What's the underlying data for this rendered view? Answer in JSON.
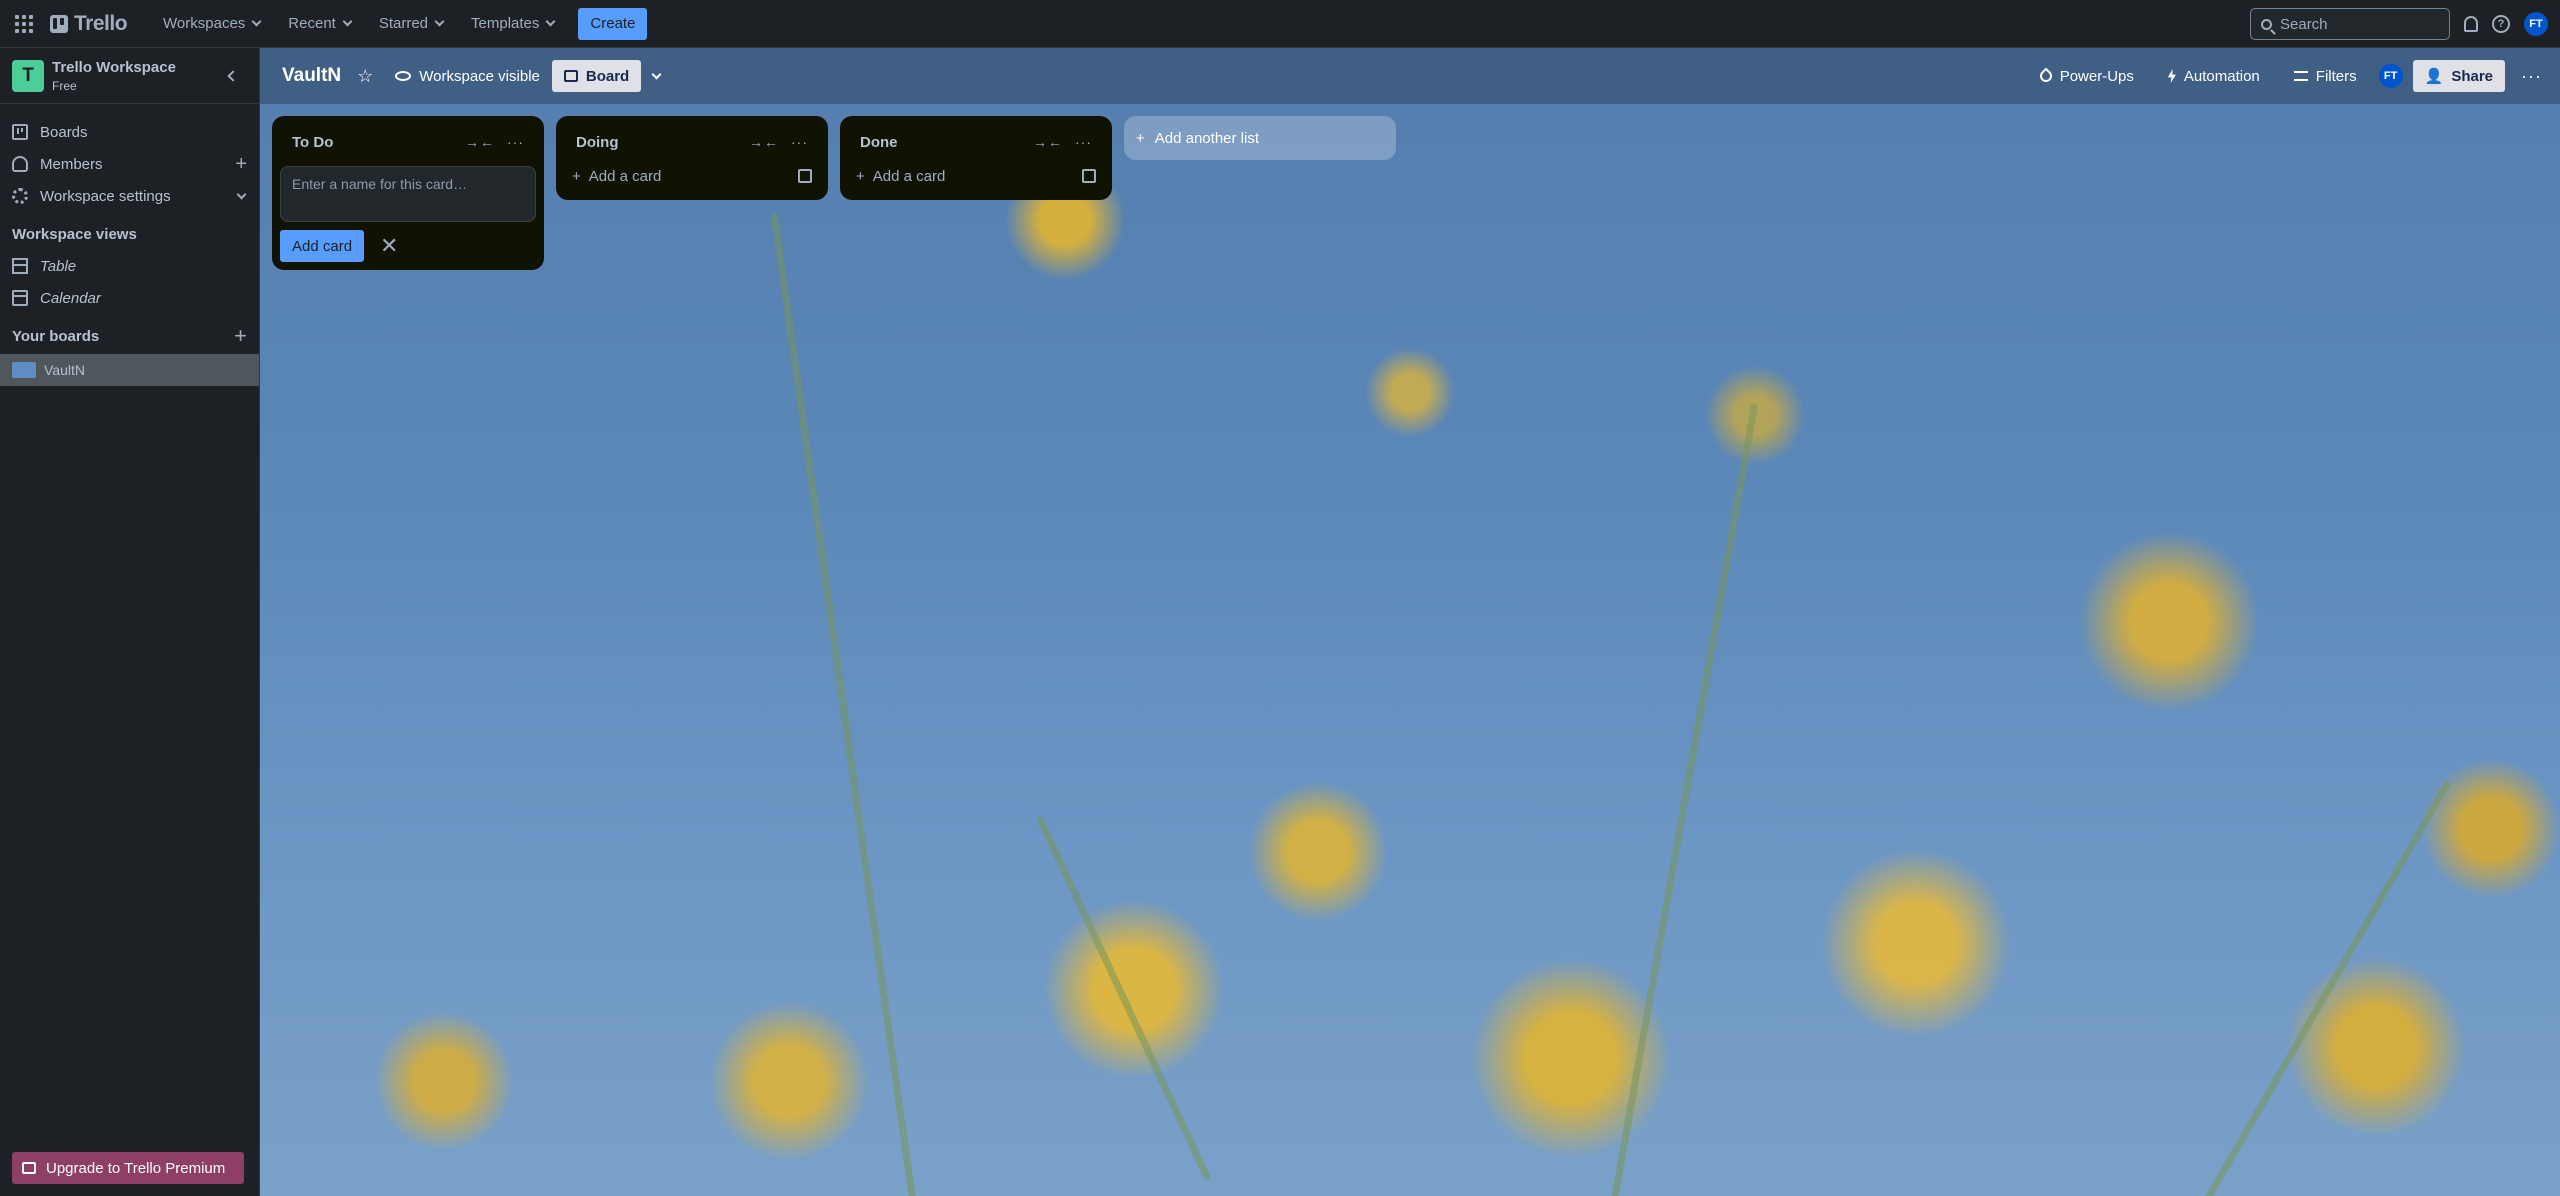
{
  "topnav": {
    "logo": "Trello",
    "menus": [
      {
        "label": "Workspaces"
      },
      {
        "label": "Recent"
      },
      {
        "label": "Starred"
      },
      {
        "label": "Templates"
      }
    ],
    "create_label": "Create",
    "search_placeholder": "Search",
    "avatar_initials": "FT"
  },
  "sidebar": {
    "workspace_initial": "T",
    "workspace_name": "Trello Workspace",
    "workspace_plan": "Free",
    "items": [
      {
        "label": "Boards"
      },
      {
        "label": "Members"
      },
      {
        "label": "Workspace settings"
      }
    ],
    "views_heading": "Workspace views",
    "views": [
      {
        "label": "Table"
      },
      {
        "label": "Calendar"
      }
    ],
    "boards_heading": "Your boards",
    "boards": [
      {
        "label": "VaultN"
      }
    ],
    "upgrade_label": "Upgrade to Trello Premium"
  },
  "board": {
    "title": "VaultN",
    "visibility_label": "Workspace visible",
    "view_label": "Board",
    "powerups_label": "Power-Ups",
    "automation_label": "Automation",
    "filters_label": "Filters",
    "avatar_initials": "FT",
    "share_label": "Share",
    "lists": [
      {
        "title": "To Do",
        "composer_placeholder": "Enter a name for this card…",
        "add_card_button": "Add card"
      },
      {
        "title": "Doing",
        "add_card_label": "Add a card"
      },
      {
        "title": "Done",
        "add_card_label": "Add a card"
      }
    ],
    "add_list_label": "Add another list"
  },
  "colors": {
    "accent": "#579dff",
    "nav_bg": "#1d2125",
    "list_bg": "#101204",
    "upgrade_bg": "#8f3f65"
  }
}
